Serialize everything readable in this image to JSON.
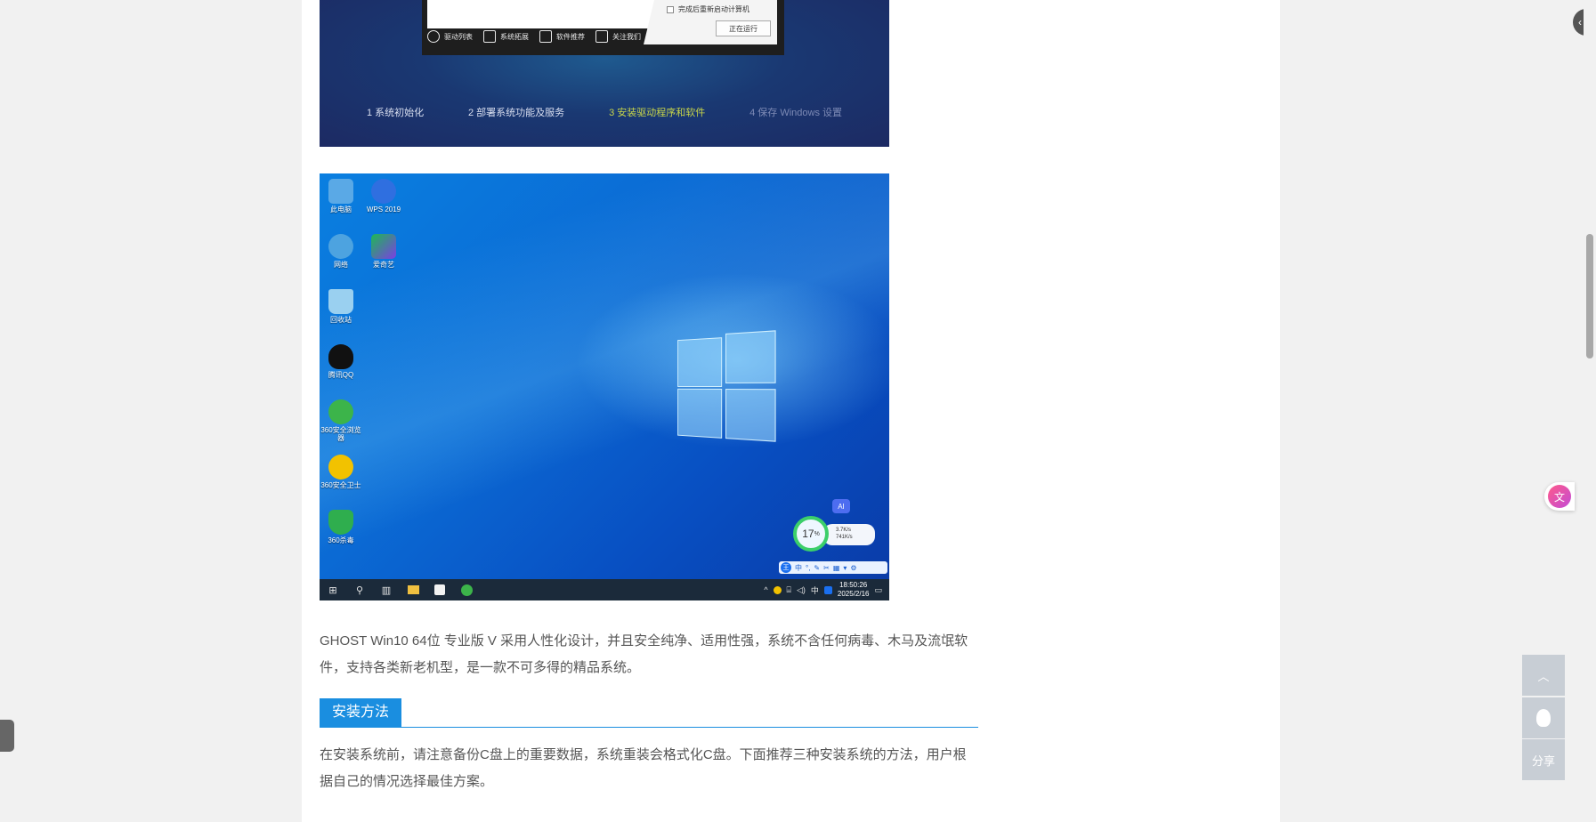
{
  "installer": {
    "checkbox_label": "完成后重新启动计算机",
    "run_button": "正在运行",
    "tools": [
      {
        "icon": "gear-icon",
        "label": "驱动列表"
      },
      {
        "icon": "monitor-icon",
        "label": "系统拓展"
      },
      {
        "icon": "list-icon",
        "label": "软件推荐"
      },
      {
        "icon": "document-icon",
        "label": "关注我们"
      }
    ],
    "steps": [
      {
        "label": "1  系统初始化",
        "state": "done"
      },
      {
        "label": "2  部署系统功能及服务",
        "state": "done"
      },
      {
        "label": "3  安装驱动程序和软件",
        "state": "active"
      },
      {
        "label": "4  保存 Windows 设置",
        "state": "pending"
      }
    ],
    "colors": {
      "active_step": "#c7d54a"
    }
  },
  "desktop": {
    "icons": [
      {
        "name": "computer-icon",
        "label": "此电脑",
        "color": "#5aa9e6"
      },
      {
        "name": "wps-icon",
        "label": "WPS 2019",
        "color": "#2f6fe0"
      },
      {
        "name": "network-icon",
        "label": "网络",
        "color": "#4da3e0"
      },
      {
        "name": "iqiyi-icon",
        "label": "爱奇艺",
        "color": "#1db954"
      },
      {
        "name": "recycle-bin-icon",
        "label": "回收站",
        "color": "#9ad0f0"
      },
      {
        "name": "qq-icon",
        "label": "腾讯QQ",
        "color": "#111111"
      },
      {
        "name": "browser-360-icon",
        "label": "360安全浏览器",
        "color": "#3cb44a"
      },
      {
        "name": "guard-360-icon",
        "label": "360安全卫士",
        "color": "#f2c200"
      },
      {
        "name": "antivirus-360-icon",
        "label": "360杀毒",
        "color": "#2fae4e"
      }
    ],
    "widget": {
      "percent": "17",
      "percent_unit": "%",
      "up": "3.7K/s",
      "down": "741K/s",
      "ai_badge": "AI"
    },
    "ime": {
      "label": "中",
      "badge": "王"
    },
    "tray": {
      "ime_label": "中",
      "time": "18:50:26",
      "date": "2025/2/16"
    }
  },
  "article": {
    "intro": "GHOST Win10 64位 专业版 V 采用人性化设计，并且安全纯净、适用性强，系统不含任何病毒、木马及流氓软件，支持各类新老机型，是一款不可多得的精品系统。",
    "section_title": "安装方法",
    "section_text": "在安装系统前，请注意备份C盘上的重要数据，系统重装会格式化C盘。下面推荐三种安装系统的方法，用户根据自己的情况选择最佳方案。"
  },
  "sidebar": {
    "back_to_top": "︿",
    "share": "分享"
  },
  "colors": {
    "accent": "#1a8ee0",
    "side_button": "#c8ced5"
  }
}
